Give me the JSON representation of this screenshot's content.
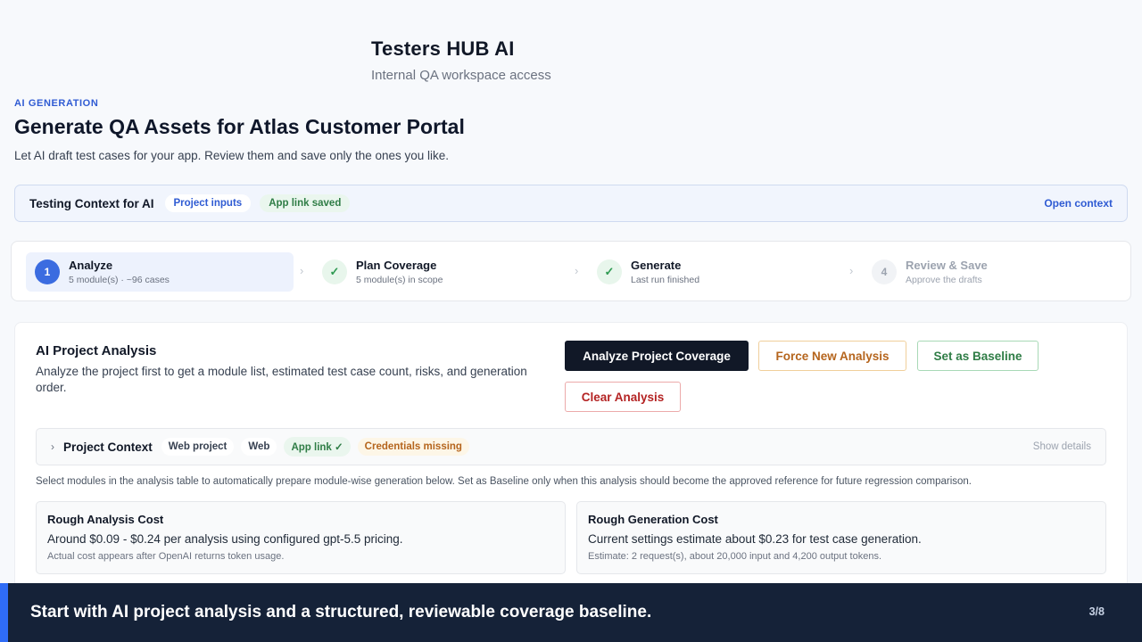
{
  "app": {
    "title": "Testers HUB AI",
    "subtitle": "Internal QA workspace access"
  },
  "page": {
    "eyebrow": "AI GENERATION",
    "title": "Generate QA Assets for Atlas Customer Portal",
    "description": "Let AI draft test cases for your app. Review them and save only the ones you like."
  },
  "context_bar": {
    "title": "Testing Context for AI",
    "pill_project_inputs": "Project inputs",
    "pill_app_link": "App link saved",
    "open_link": "Open context"
  },
  "steps": [
    {
      "number": "1",
      "title": "Analyze",
      "subtitle": "5 module(s) · ~96 cases",
      "state": "active"
    },
    {
      "number": "✓",
      "title": "Plan Coverage",
      "subtitle": "5 module(s) in scope",
      "state": "done"
    },
    {
      "number": "✓",
      "title": "Generate",
      "subtitle": "Last run finished",
      "state": "done"
    },
    {
      "number": "4",
      "title": "Review & Save",
      "subtitle": "Approve the drafts",
      "state": "todo"
    }
  ],
  "step_separator": "›",
  "analysis": {
    "title": "AI Project Analysis",
    "description": "Analyze the project first to get a module list, estimated test case count, risks, and generation order.",
    "buttons": {
      "analyze": "Analyze Project Coverage",
      "force": "Force New Analysis",
      "baseline": "Set as Baseline",
      "clear": "Clear Analysis"
    },
    "project_context": {
      "chevron": "›",
      "title": "Project Context",
      "tag_web_project": "Web project",
      "tag_web": "Web",
      "tag_app_link": "App link ✓",
      "tag_credentials": "Credentials missing",
      "show_details": "Show details"
    },
    "note": "Select modules in the analysis table to automatically prepare module-wise generation below. Set as Baseline only when this analysis should become the approved reference for future regression comparison.",
    "cost_analysis": {
      "title": "Rough Analysis Cost",
      "main": "Around $0.09 - $0.24 per analysis using configured gpt-5.5 pricing.",
      "sub": "Actual cost appears after OpenAI returns token usage."
    },
    "cost_generation": {
      "title": "Rough Generation Cost",
      "main": "Current settings estimate about $0.23 for test case generation.",
      "sub": "Estimate: 2 request(s), about 20,000 input and 4,200 output tokens."
    }
  },
  "banner": {
    "text": "Start with AI project analysis and a structured, reviewable coverage baseline.",
    "page_indicator": "3/8"
  },
  "colors": {
    "accent": "#2f5bd3",
    "banner_bg": "#152238",
    "banner_accent": "#2f6cf6",
    "success": "#2f7d46",
    "warning": "#b5651d",
    "danger": "#b42323"
  }
}
